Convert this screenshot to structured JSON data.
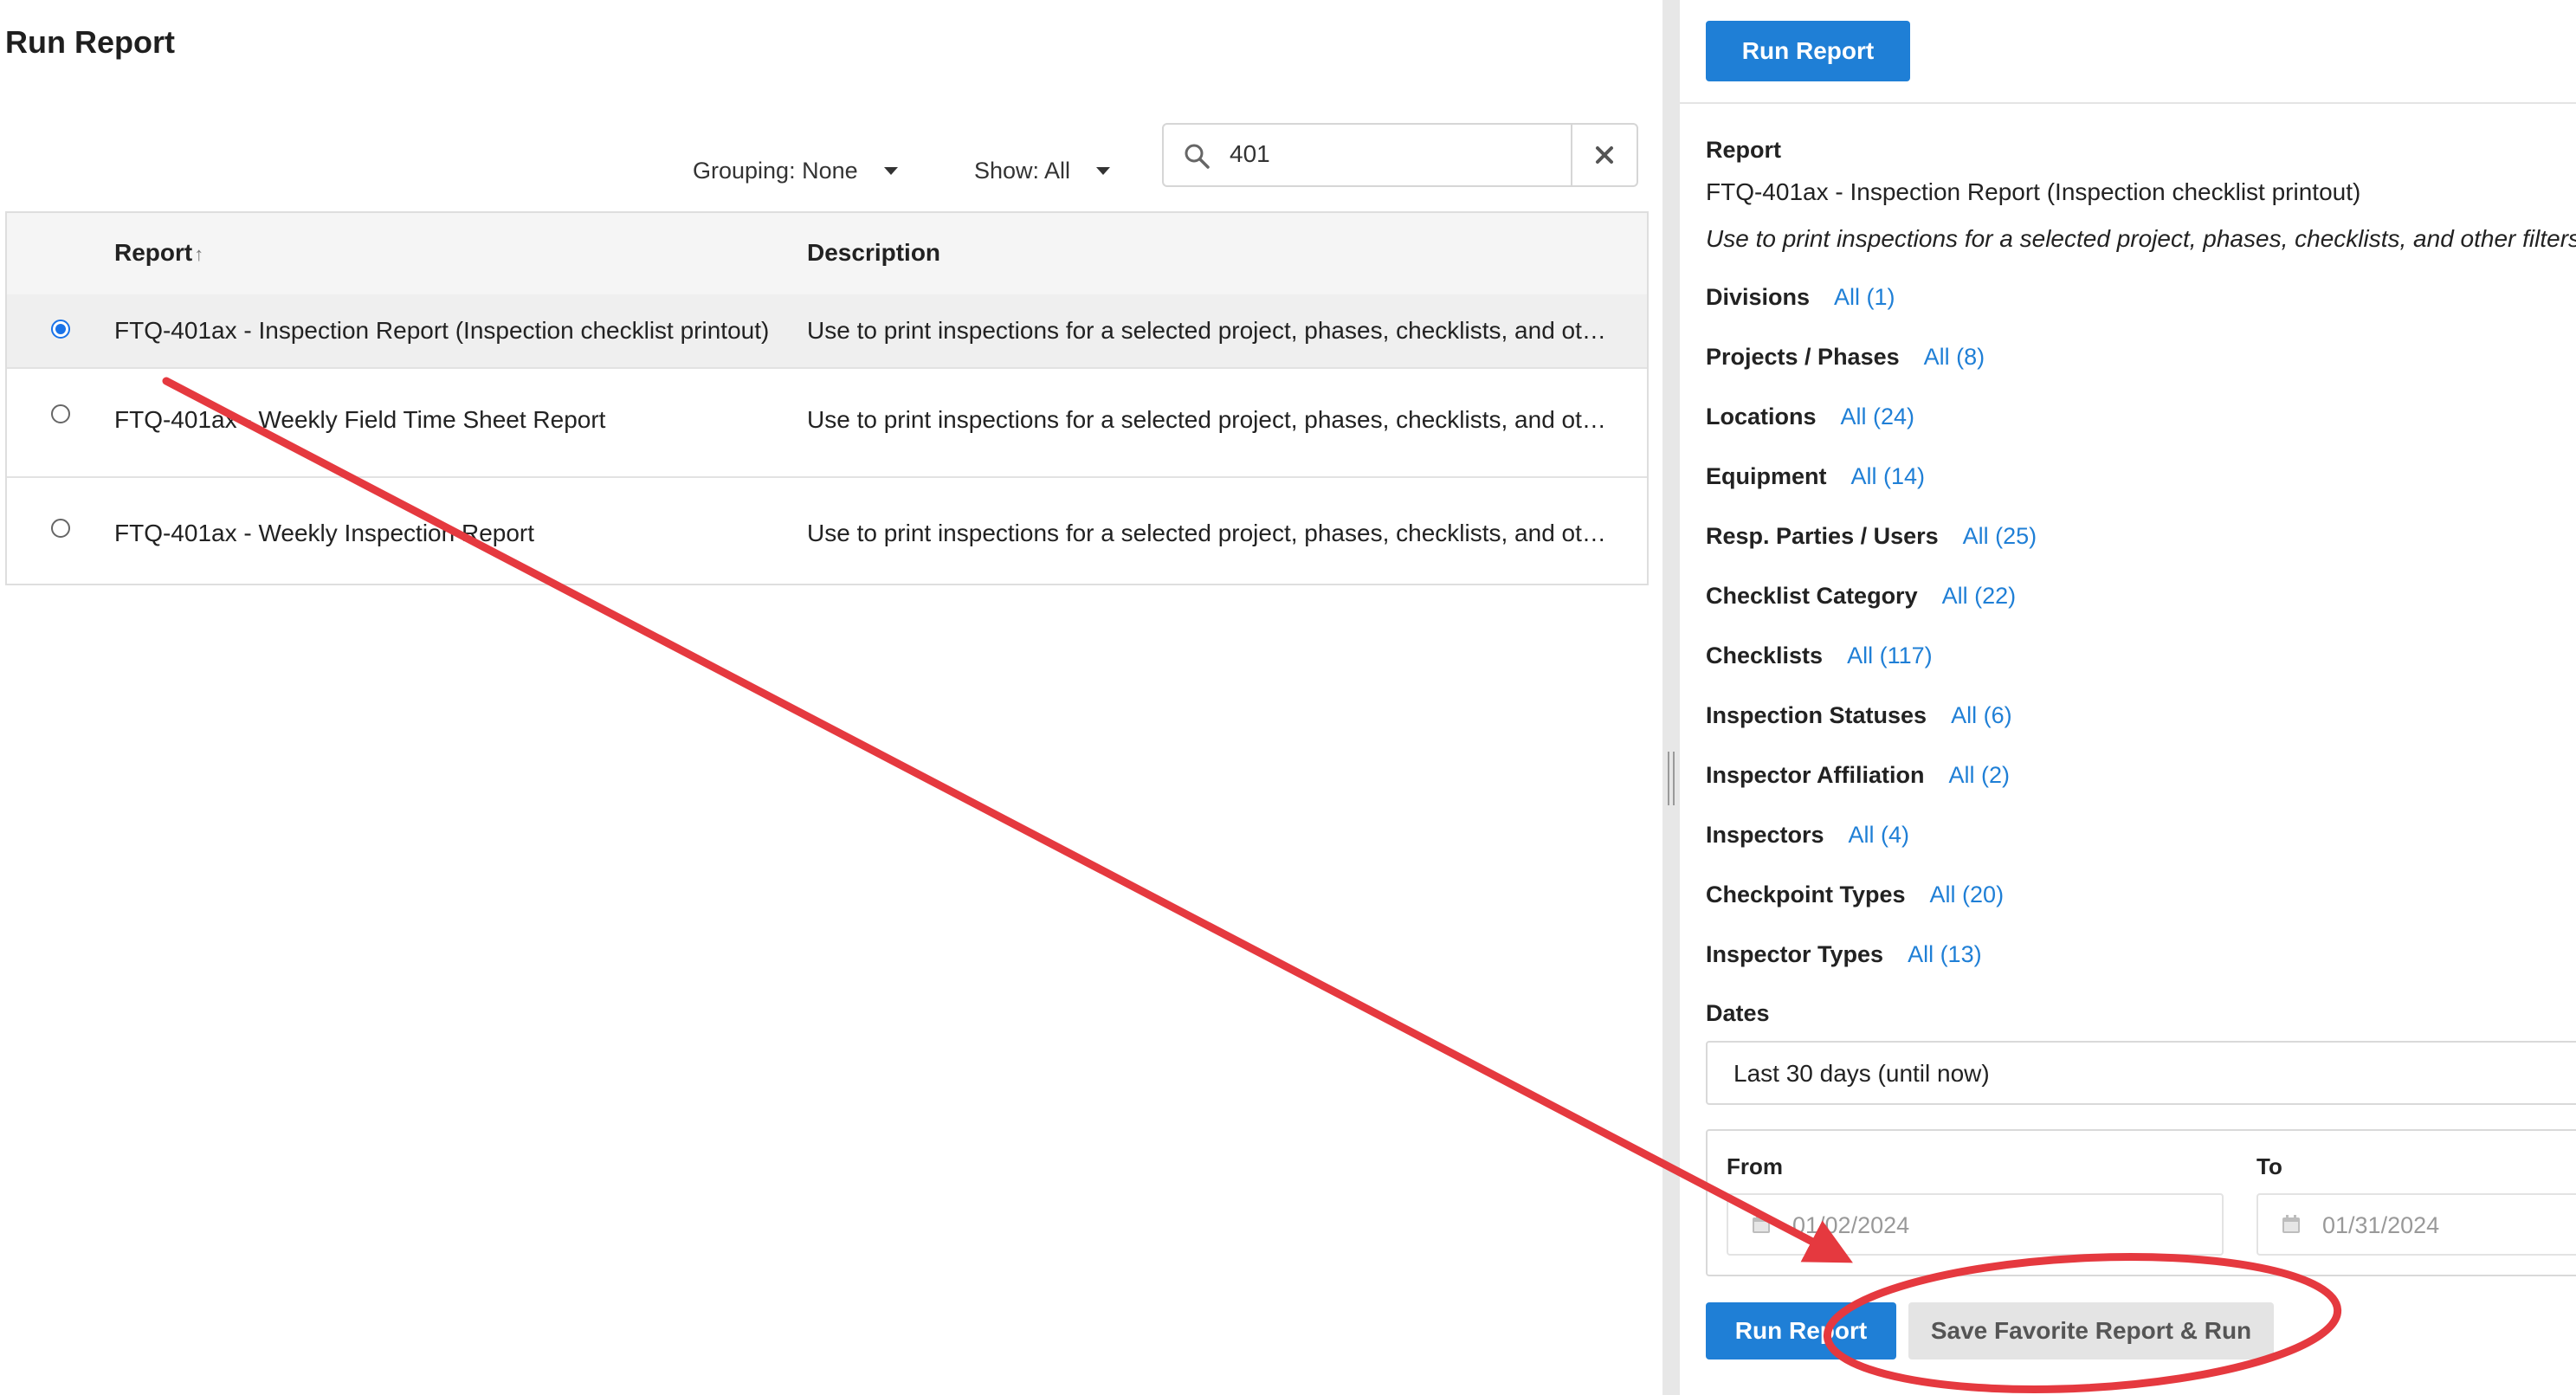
{
  "page_title": "Run Report",
  "toolbar": {
    "grouping_label": "Grouping: None",
    "show_label": "Show: All",
    "search_value": "401"
  },
  "table": {
    "headers": {
      "report": "Report",
      "description": "Description"
    },
    "sort_indicator": "↑",
    "rows": [
      {
        "name": "FTQ-401ax - Inspection Report (Inspection checklist printout)",
        "description": "Use to print inspections for a selected project, phases, checklists, and ot…",
        "selected": true
      },
      {
        "name": "FTQ-401ax - Weekly Field Time Sheet Report",
        "description": "Use to print inspections for a selected project, phases, checklists, and ot…",
        "selected": false
      },
      {
        "name": "FTQ-401ax - Weekly Inspection Report",
        "description": "Use to print inspections for a selected project, phases, checklists, and ot…",
        "selected": false
      }
    ]
  },
  "panel": {
    "run_report_top": "Run Report",
    "report_label": "Report",
    "report_name": "FTQ-401ax - Inspection Report (Inspection checklist printout)",
    "report_description": "Use to print inspections for a selected project, phases, checklists, and other filters",
    "filters": [
      {
        "label": "Divisions",
        "value": "All (1)"
      },
      {
        "label": "Projects / Phases",
        "value": "All (8)"
      },
      {
        "label": "Locations",
        "value": "All (24)"
      },
      {
        "label": "Equipment",
        "value": "All (14)"
      },
      {
        "label": "Resp. Parties / Users",
        "value": "All (25)"
      },
      {
        "label": "Checklist Category",
        "value": "All (22)"
      },
      {
        "label": "Checklists",
        "value": "All (117)"
      },
      {
        "label": "Inspection Statuses",
        "value": "All (6)"
      },
      {
        "label": "Inspector Affiliation",
        "value": "All (2)"
      },
      {
        "label": "Inspectors",
        "value": "All (4)"
      },
      {
        "label": "Checkpoint Types",
        "value": "All (20)"
      },
      {
        "label": "Inspector Types",
        "value": "All (13)"
      }
    ],
    "dates_label": "Dates",
    "dates_value": "Last 30 days (until now)",
    "from_label": "From",
    "from_value": "01/02/2024",
    "to_label": "To",
    "to_value": "01/31/2024",
    "run_report_bottom": "Run Report",
    "save_favorite": "Save Favorite Report & Run"
  },
  "colors": {
    "accent": "#1f7fd6",
    "annotation": "#e5393f",
    "selected_row": "#efefef"
  },
  "icons": [
    "search-icon",
    "close-icon",
    "caret-down-icon",
    "calendar-icon",
    "sort-up-icon",
    "splitter-grip-icon"
  ]
}
